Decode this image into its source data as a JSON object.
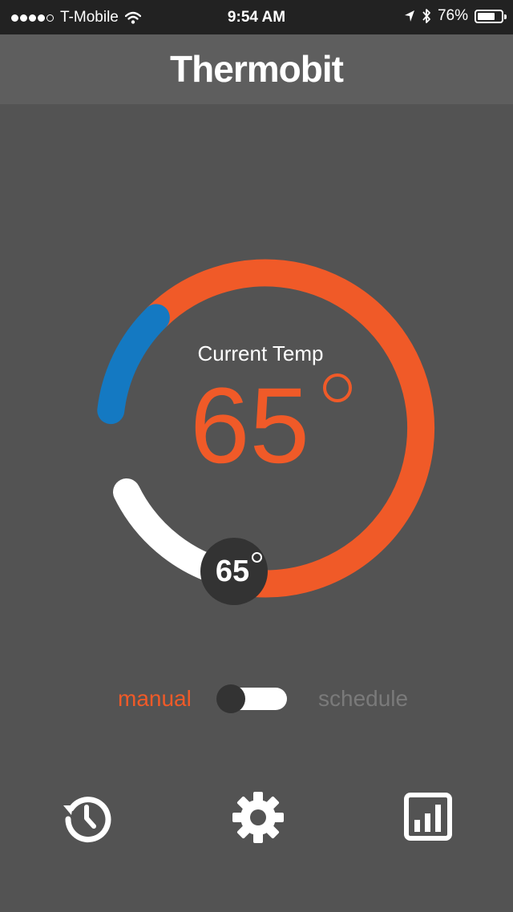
{
  "status_bar": {
    "carrier": "T-Mobile",
    "time": "9:54 AM",
    "battery": "76%",
    "battery_level": 0.76,
    "signal_bars_filled": 4,
    "signal_bars_total": 5
  },
  "header": {
    "app_name": "Thermobit"
  },
  "thermostat": {
    "current_label": "Current Temp",
    "current_temp": "65",
    "set_temp": "65",
    "colors": {
      "heat": "#f05a28",
      "cool": "#1479c2",
      "setpoint_track": "#ffffff",
      "knob": "#333333"
    }
  },
  "mode": {
    "manual_label": "manual",
    "schedule_label": "schedule",
    "selected": "manual"
  },
  "nav": {
    "items": [
      {
        "name": "history",
        "icon": "history-clock-icon"
      },
      {
        "name": "settings",
        "icon": "gear-icon"
      },
      {
        "name": "stats",
        "icon": "bar-chart-icon"
      }
    ]
  }
}
